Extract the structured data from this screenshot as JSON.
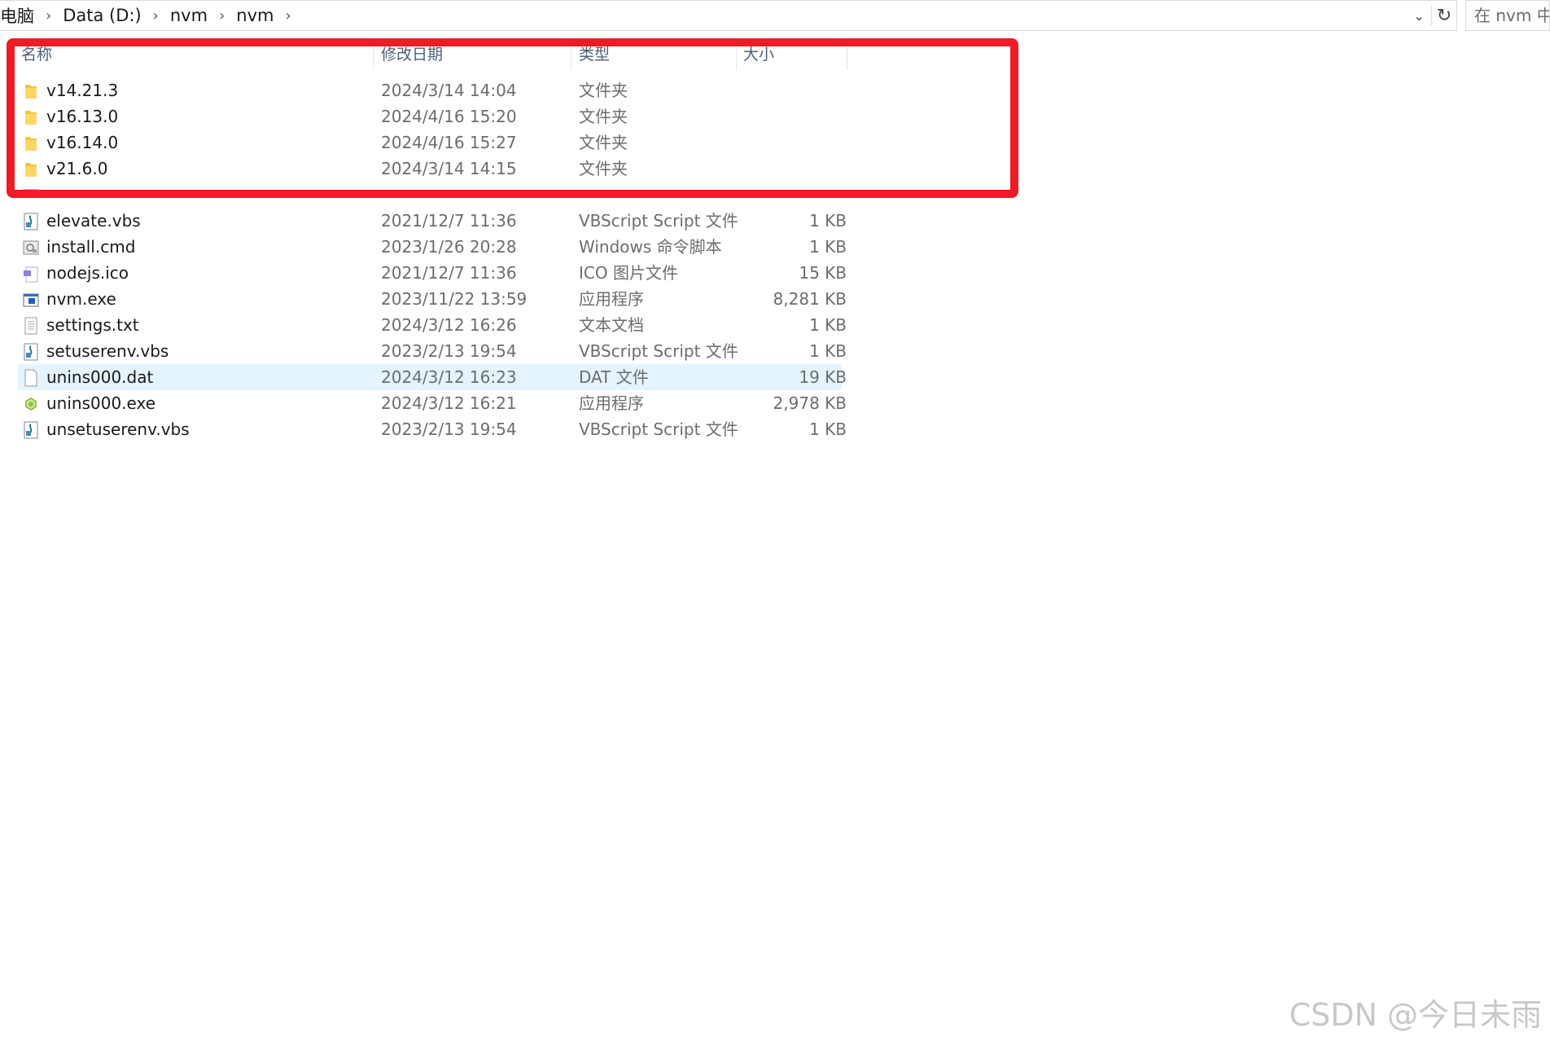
{
  "address_bar": {
    "crumbs": [
      "电脑",
      "Data (D:)",
      "nvm",
      "nvm"
    ],
    "search_placeholder": "在 nvm 中搜"
  },
  "columns": {
    "name": "名称",
    "date": "修改日期",
    "type": "类型",
    "size": "大小"
  },
  "folders": [
    {
      "name": "v14.21.3",
      "date": "2024/3/14 14:04",
      "type": "文件夹",
      "size": ""
    },
    {
      "name": "v16.13.0",
      "date": "2024/4/16 15:20",
      "type": "文件夹",
      "size": ""
    },
    {
      "name": "v16.14.0",
      "date": "2024/4/16 15:27",
      "type": "文件夹",
      "size": ""
    },
    {
      "name": "v21.6.0",
      "date": "2024/3/14 14:15",
      "type": "文件夹",
      "size": ""
    }
  ],
  "files": [
    {
      "name": "elevate.vbs",
      "date": "2021/12/7 11:36",
      "type": "VBScript Script 文件",
      "size": "1 KB",
      "icon": "vbs-script-icon"
    },
    {
      "name": "install.cmd",
      "date": "2023/1/26 20:28",
      "type": "Windows 命令脚本",
      "size": "1 KB",
      "icon": "cmd-script-icon"
    },
    {
      "name": "nodejs.ico",
      "date": "2021/12/7 11:36",
      "type": "ICO 图片文件",
      "size": "15 KB",
      "icon": "ico-file-icon"
    },
    {
      "name": "nvm.exe",
      "date": "2023/11/22 13:59",
      "type": "应用程序",
      "size": "8,281 KB",
      "icon": "exe-app-icon"
    },
    {
      "name": "settings.txt",
      "date": "2024/3/12 16:26",
      "type": "文本文档",
      "size": "1 KB",
      "icon": "text-file-icon"
    },
    {
      "name": "setuserenv.vbs",
      "date": "2023/2/13 19:54",
      "type": "VBScript Script 文件",
      "size": "1 KB",
      "icon": "vbs-script-icon"
    },
    {
      "name": "unins000.dat",
      "date": "2024/3/12 16:23",
      "type": "DAT 文件",
      "size": "19 KB",
      "icon": "blank-file-icon",
      "selected": true
    },
    {
      "name": "unins000.exe",
      "date": "2024/3/12 16:21",
      "type": "应用程序",
      "size": "2,978 KB",
      "icon": "uninstaller-icon"
    },
    {
      "name": "unsetuserenv.vbs",
      "date": "2023/2/13 19:54",
      "type": "VBScript Script 文件",
      "size": "1 KB",
      "icon": "vbs-script-icon"
    }
  ],
  "watermark": "CSDN @今日未雨",
  "colors": {
    "highlight_box": "#ee1c25",
    "selected_row": "#e5f3ff",
    "folder": "#f5c242"
  }
}
